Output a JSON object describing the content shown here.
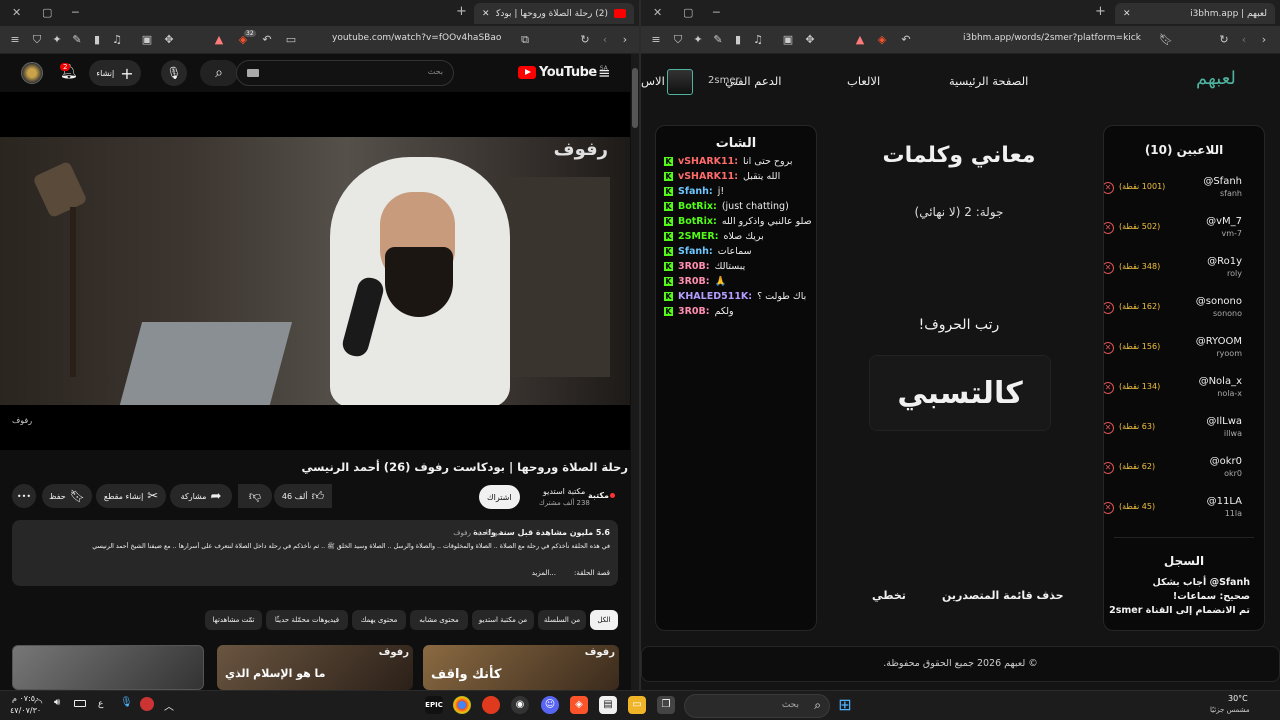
{
  "left_window": {
    "tab_title": "(2) رحلة الصلاة وروحها | بودكاست",
    "tab_badge": "",
    "url": "youtube.com/watch?v=fOOv4haSBao",
    "brave_badge": "32",
    "youtube": {
      "logo": "YouTube",
      "logo_region": "SA",
      "search_placeholder": "بحث",
      "create_label": "إنشاء",
      "notif_count": "2",
      "video_watermark": "رفوف",
      "video_corner_label": "رفوف",
      "title": "رحلة الصلاة وروحها | بودكاست رفوف (26) أحمد الرنيسي",
      "channel_name": "مكتبة استديو",
      "channel_subs": "238 ألف مشترك",
      "channel_logo_text": "مكتبة",
      "subscribe_label": "اشتراك",
      "like_count": "46 ألف",
      "share_label": "مشاركة",
      "clip_label": "إنشاء مقطع",
      "save_label": "حفظ",
      "more_icon": "more-icon",
      "description": {
        "stats": "5.6 مليون مشاهدة قبل سنة واحدة",
        "tags": "بودكاست رفوف",
        "line1": "في هذه الحلقة نأخذكم في رحلة مع الصلاة .. الصلاة والمخلوقات .. والصلاة والرسل .. الصلاة وسيد الخلق ﷺ .. ثم نأخذكم في رحلة داخل الصلاة لنتعرف على أسرارها .. مع ضيفنا الشيخ أحمد الرنيسي",
        "line2": "قصة الحلقة:",
        "more": "...المزيد"
      },
      "chips": [
        "الكل",
        "من السلسلة",
        "من مكتبة استديو",
        "محتوى مشابه",
        "محتوى يهمك",
        "فيديوهات محمّلة حديثًا",
        "تمّت مشاهدتها"
      ],
      "thumbs": [
        "كأنك واقف",
        "ما هو الإسلام الذي",
        ""
      ],
      "thumb_brand": "رفوف"
    }
  },
  "right_window": {
    "tab_title": "لعبهم | i3bhm.app",
    "url": "i3bhm.app/words/2smer?platform=kick",
    "brand": "لعبهم",
    "nav": {
      "home": "الصفحة الرئيسية",
      "games": "الالعاب",
      "support": "الدعم الفني",
      "login_partial": "الاس",
      "user": "2smer"
    },
    "players_panel": {
      "title": "اللاعبين (10)",
      "players": [
        {
          "name": "@Sfanh",
          "user": "sfanh",
          "points": "(1001 نقطة)"
        },
        {
          "name": "@vM_7",
          "user": "vm-7",
          "points": "(502 نقطة)"
        },
        {
          "name": "@Ro1y",
          "user": "roly",
          "points": "(348 نقطة)"
        },
        {
          "name": "@sonono",
          "user": "sonono",
          "points": "(162 نقطة)"
        },
        {
          "name": "@RYOOM",
          "user": "ryoom",
          "points": "(156 نقطة)"
        },
        {
          "name": "@Nola_x",
          "user": "nola-x",
          "points": "(134 نقطة)"
        },
        {
          "name": "@IlLwa",
          "user": "illwa",
          "points": "(63 نقطة)"
        },
        {
          "name": "@okr0",
          "user": "okr0",
          "points": "(62 نقطة)"
        },
        {
          "name": "@11LA",
          "user": "11la",
          "points": "(45 نقطة)"
        }
      ]
    },
    "log_panel": {
      "title": "السجل",
      "lines": [
        "Sfanh@ أجاب بشكل",
        "صحيح: سماعات!",
        "تم الانضمام إلى القناة 2smer"
      ]
    },
    "game": {
      "title": "معاني وكلمات",
      "round": "جولة: 2 (لا نهائي)",
      "prompt": "رتب الحروف!",
      "scrambled": "كالتسبي",
      "clear_leaderboard": "حذف قائمة المتصدرين",
      "skip": "تخطي"
    },
    "chat_panel": {
      "title": "الشات",
      "messages": [
        {
          "user": "vSHARK11:",
          "text": "بروح حتى انا",
          "color": "#ff6b6b"
        },
        {
          "user": "vSHARK11:",
          "text": "الله يتقبل",
          "color": "#ff6b6b"
        },
        {
          "user": "Sfanh:",
          "text": "!j",
          "color": "#6ec6ff"
        },
        {
          "user": "BotRix:",
          "text": "(just chatting)",
          "color": "#53fc18"
        },
        {
          "user": "BotRix:",
          "text": "صلو عالنبي واذكرو الله",
          "color": "#53fc18"
        },
        {
          "user": "2SMER:",
          "text": "بريك صلاه",
          "color": "#53fc18"
        },
        {
          "user": "Sfanh:",
          "text": "سماعات",
          "color": "#6ec6ff"
        },
        {
          "user": "3R0B:",
          "text": "يبستالك",
          "color": "#ff8fb0"
        },
        {
          "user": "3R0B:",
          "text": "🙏",
          "color": "#ff8fb0"
        },
        {
          "user": "KHALED511K:",
          "text": "باك طولت ؟",
          "color": "#b39dff"
        },
        {
          "user": "3R0B:",
          "text": "ولكم",
          "color": "#ff8fb0"
        }
      ]
    },
    "footer": "© لعبهم 2026 جميع الحقوق محفوظة."
  },
  "taskbar": {
    "time": "٠٧:٥٠ م",
    "date": "٤٧/٠٧/٣٠",
    "lang": "ع",
    "search_placeholder": "بحث",
    "weather_temp": "30°C",
    "weather_desc": "مشمس جزئيًا"
  },
  "colors": {
    "youtube_red": "#ff0000",
    "kick_green": "#53fc18",
    "points_gold": "#f0c040",
    "brand_teal": "#4fb3a0"
  }
}
